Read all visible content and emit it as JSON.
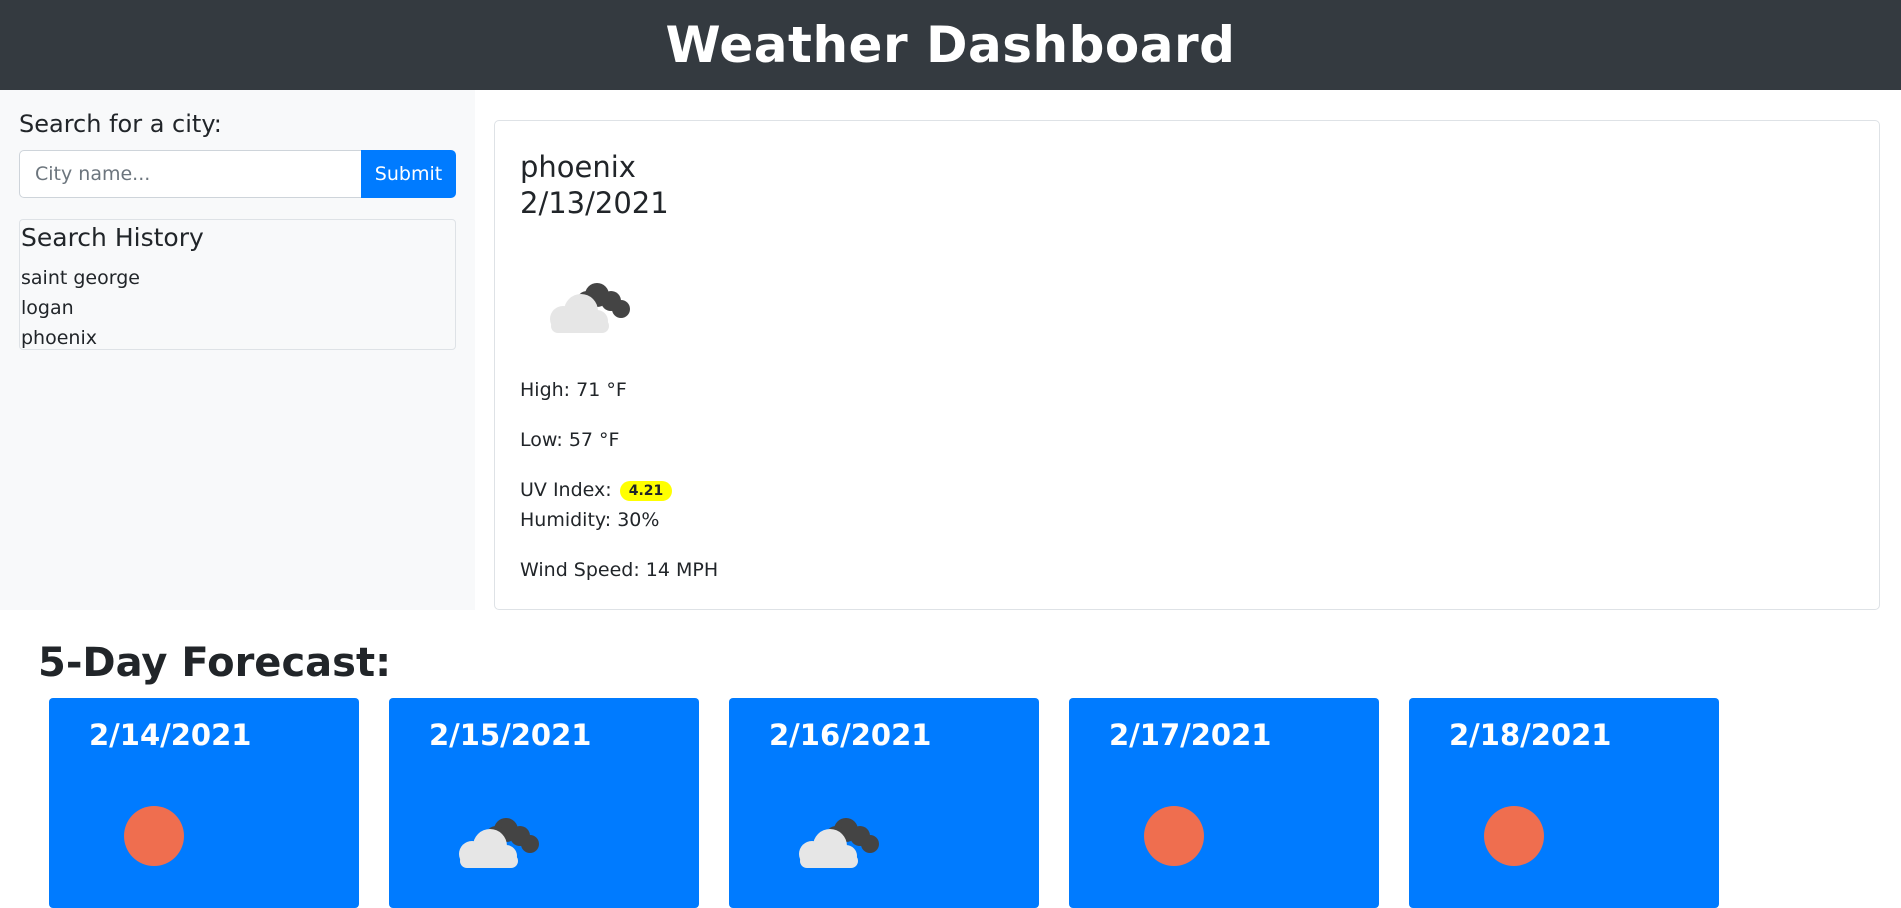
{
  "header": {
    "title": "Weather Dashboard"
  },
  "sidebar": {
    "search_label": "Search for a city:",
    "search_placeholder": "City name...",
    "submit_label": "Submit",
    "history_title": "Search History",
    "history": [
      "saint george",
      "logan",
      "phoenix"
    ]
  },
  "current": {
    "city": "phoenix",
    "date": "2/13/2021",
    "icon": "cloudy-icon",
    "high": "High: 71 °F",
    "low": "Low: 57 °F",
    "uv_label": "UV Index:",
    "uv_value": "4.21",
    "uv_color": "#ffff00",
    "humidity": "Humidity: 30%",
    "wind": "Wind Speed: 14 MPH"
  },
  "forecast": {
    "title": "5-Day Forecast:",
    "days": [
      {
        "date": "2/14/2021",
        "icon": "sun-icon"
      },
      {
        "date": "2/15/2021",
        "icon": "cloudy-icon"
      },
      {
        "date": "2/16/2021",
        "icon": "cloudy-icon"
      },
      {
        "date": "2/17/2021",
        "icon": "sun-icon"
      },
      {
        "date": "2/18/2021",
        "icon": "sun-icon"
      }
    ]
  },
  "colors": {
    "header_bg": "#343a40",
    "accent": "#007bff",
    "sun": "#ef6e4f",
    "uv_badge": "#ffff00"
  }
}
